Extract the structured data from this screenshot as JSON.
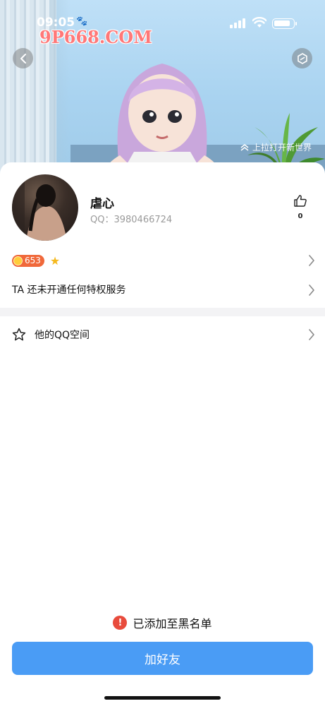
{
  "status_bar": {
    "time": "09:05"
  },
  "watermark": {
    "text": "9P668.COM"
  },
  "banner": {
    "hint": "上拉打开新世界"
  },
  "profile": {
    "nickname": "虐心",
    "qq_label": "QQ：",
    "qq_number": "3980466724",
    "like_count": "0",
    "level": "653"
  },
  "rows": {
    "privilege": "TA 还未开通任何特权服务",
    "qzone": "他的QQ空间"
  },
  "toast": {
    "icon": "!",
    "text": "已添加至黑名单"
  },
  "buttons": {
    "add_friend": "加好友"
  },
  "colors": {
    "primary": "#4a9cf5",
    "alert": "#e84b3c",
    "level_badge": "#f0683a"
  }
}
